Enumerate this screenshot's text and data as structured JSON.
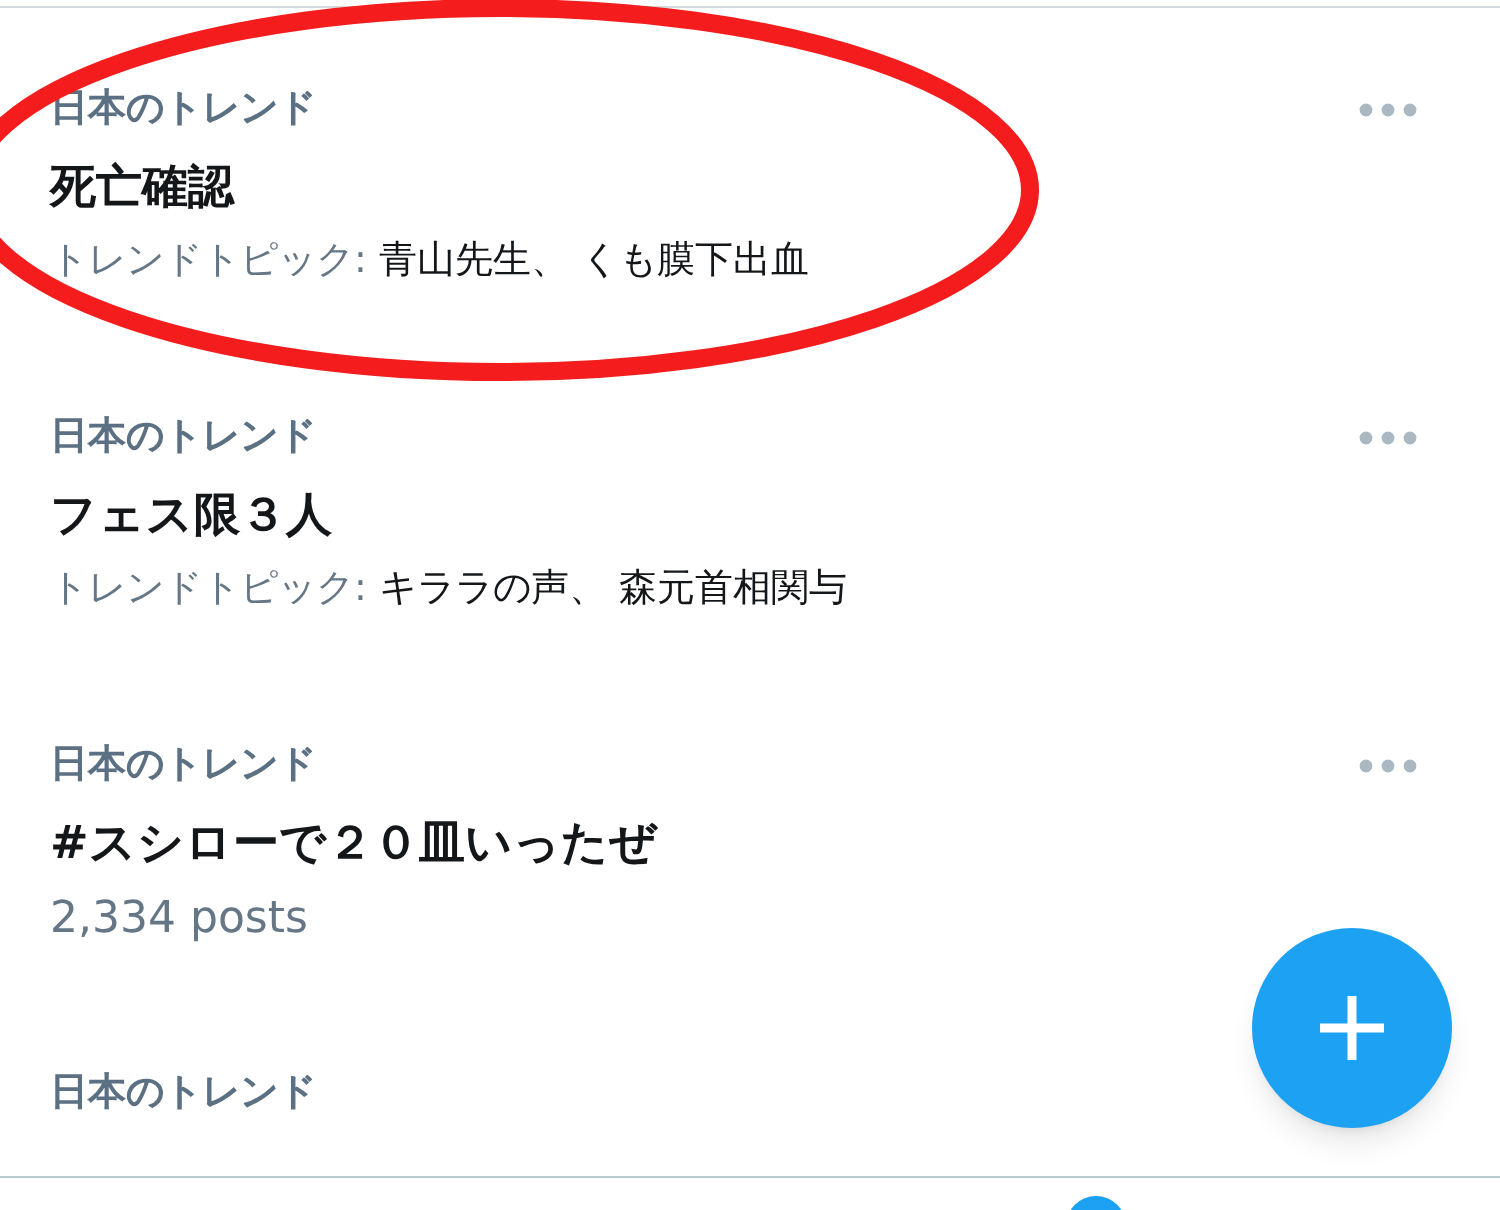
{
  "trends": [
    {
      "kind": "topics",
      "context": "日本のトレンド",
      "title": "死亡確認",
      "topics_label": "トレンドトピック:",
      "topics": "青山先生、 くも膜下出血"
    },
    {
      "kind": "topics",
      "context": "日本のトレンド",
      "title": "フェス限３人",
      "topics_label": "トレンドトピック:",
      "topics": "キララの声、 森元首相関与"
    },
    {
      "kind": "posts",
      "context": "日本のトレンド",
      "title": "#スシローで２０皿いったぜ",
      "posts": "2,334 posts"
    },
    {
      "kind": "cut",
      "context": "日本のトレンド"
    }
  ]
}
